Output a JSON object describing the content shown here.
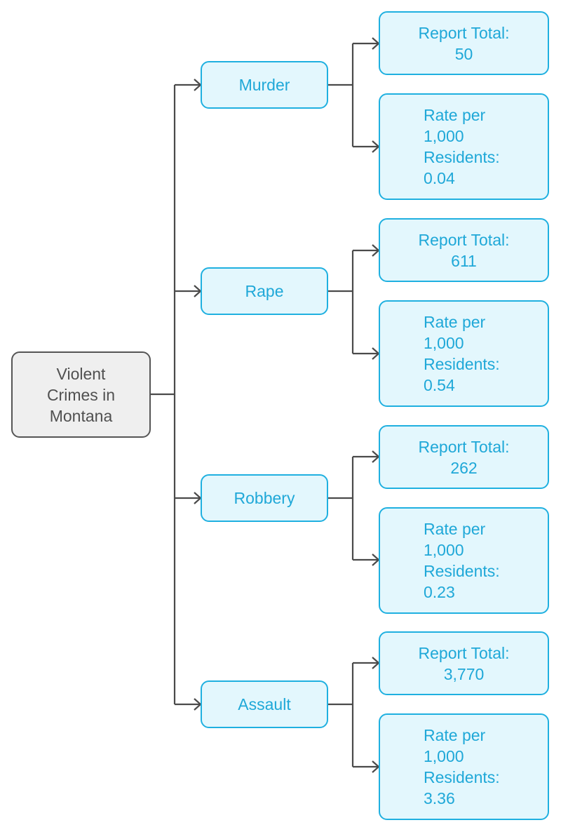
{
  "root": {
    "label_lines": [
      "Violent",
      "Crimes in",
      "Montana"
    ]
  },
  "categories": [
    {
      "name": "Murder",
      "report_total_label": "Report Total:",
      "report_total": "50",
      "rate_lines": [
        "Rate per",
        "1,000",
        "Residents:",
        "0.04"
      ]
    },
    {
      "name": "Rape",
      "report_total_label": "Report Total:",
      "report_total": "611",
      "rate_lines": [
        "Rate per",
        "1,000",
        "Residents:",
        "0.54"
      ]
    },
    {
      "name": "Robbery",
      "report_total_label": "Report Total:",
      "report_total": "262",
      "rate_lines": [
        "Rate per",
        "1,000",
        "Residents:",
        "0.23"
      ]
    },
    {
      "name": "Assault",
      "report_total_label": "Report Total:",
      "report_total": "3,770",
      "rate_lines": [
        "Rate per",
        "1,000",
        "Residents:",
        "3.36"
      ]
    }
  ],
  "colors": {
    "root_fill": "#efefef",
    "root_border": "#555555",
    "root_text": "#505050",
    "node_fill": "#e3f7fd",
    "node_border": "#1fb0e0",
    "node_text": "#1fa8d8",
    "connector": "#4a4a4a"
  }
}
